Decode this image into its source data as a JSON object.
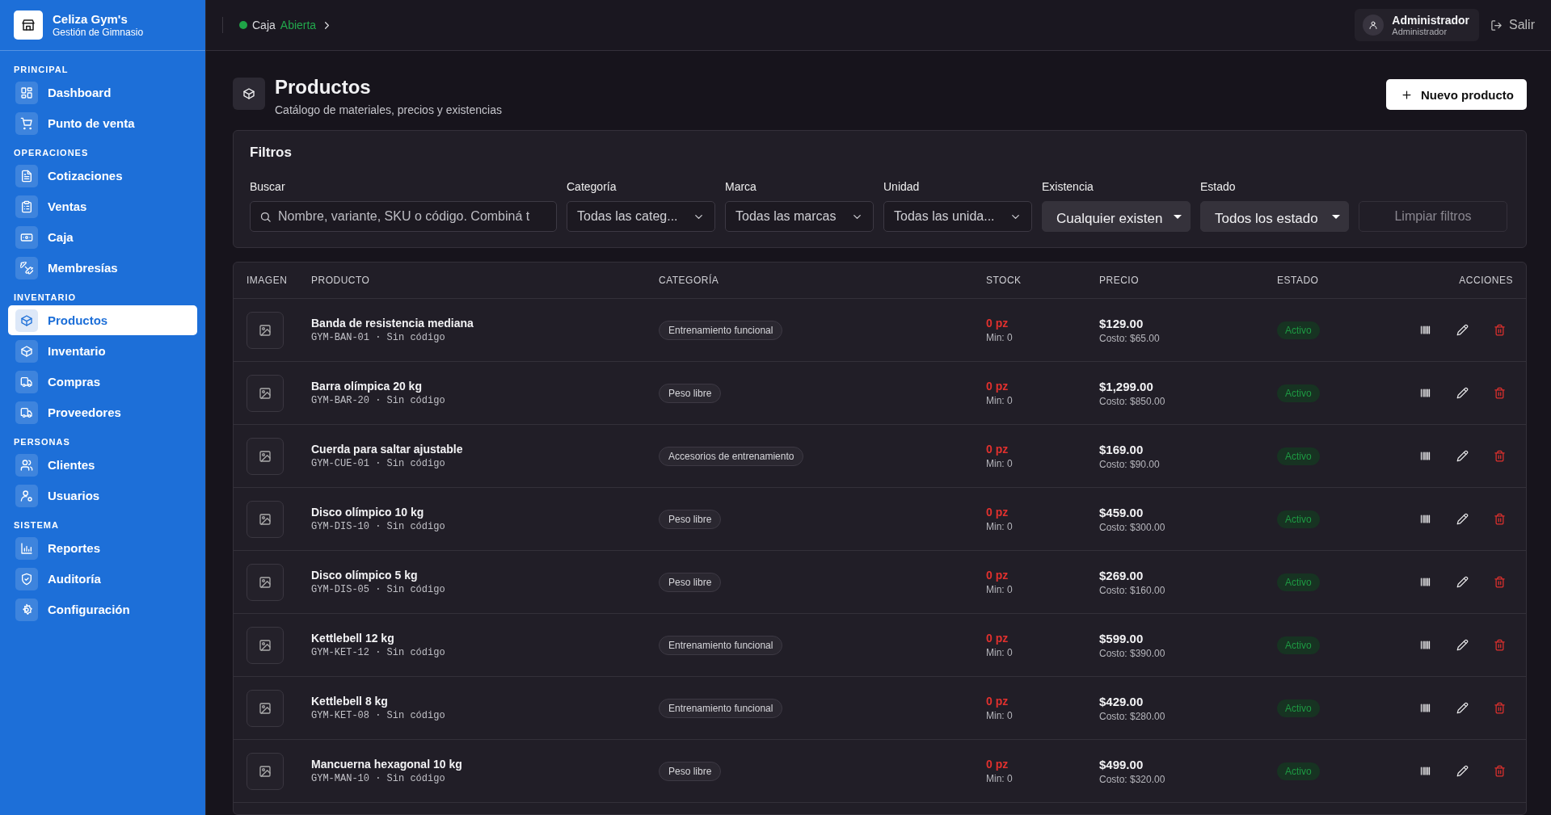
{
  "brand": {
    "name": "Celiza Gym's",
    "subtitle": "Gestión de Gimnasio"
  },
  "sidebar": {
    "sections": [
      {
        "label": "PRINCIPAL",
        "items": [
          {
            "label": "Dashboard",
            "selected": false
          },
          {
            "label": "Punto de venta",
            "selected": false
          }
        ]
      },
      {
        "label": "OPERACIONES",
        "items": [
          {
            "label": "Cotizaciones",
            "selected": false
          },
          {
            "label": "Ventas",
            "selected": false
          },
          {
            "label": "Caja",
            "selected": false
          },
          {
            "label": "Membresías",
            "selected": false
          }
        ]
      },
      {
        "label": "INVENTARIO",
        "items": [
          {
            "label": "Productos",
            "selected": true
          },
          {
            "label": "Inventario",
            "selected": false
          },
          {
            "label": "Compras",
            "selected": false
          },
          {
            "label": "Proveedores",
            "selected": false
          }
        ]
      },
      {
        "label": "PERSONAS",
        "items": [
          {
            "label": "Clientes",
            "selected": false
          },
          {
            "label": "Usuarios",
            "selected": false
          }
        ]
      },
      {
        "label": "SISTEMA",
        "items": [
          {
            "label": "Reportes",
            "selected": false
          },
          {
            "label": "Auditoría",
            "selected": false
          },
          {
            "label": "Configuración",
            "selected": false
          }
        ]
      }
    ]
  },
  "topbar": {
    "register_label": "Caja",
    "register_status": "Abierta",
    "register_open": true,
    "user_name": "Administrador",
    "user_role": "Administrador",
    "logout": "Salir"
  },
  "page": {
    "title": "Productos",
    "subtitle": "Catálogo de materiales, precios y existencias",
    "new_button": "Nuevo producto"
  },
  "filters": {
    "title": "Filtros",
    "fields": [
      {
        "kind": "search",
        "label": "Buscar",
        "placeholder": "Nombre, variante, SKU o código. Combiná t"
      },
      {
        "kind": "select",
        "label": "Categoría",
        "value": "Todas las categ..."
      },
      {
        "kind": "select",
        "label": "Marca",
        "value": "Todas las marcas"
      },
      {
        "kind": "select",
        "label": "Unidad",
        "value": "Todas las unida..."
      },
      {
        "kind": "native",
        "label": "Existencia",
        "value": "Cualquier existen"
      },
      {
        "kind": "native",
        "label": "Estado",
        "value": "Todos los estado"
      }
    ],
    "clear_button": {
      "label": "Limpiar filtros",
      "disabled": true
    }
  },
  "table": {
    "columns": [
      "IMAGEN",
      "PRODUCTO",
      "CATEGORÍA",
      "STOCK",
      "PRECIO",
      "ESTADO",
      "ACCIONES"
    ],
    "rows": [
      {
        "name": "Banda de resistencia mediana",
        "code": "GYM-BAN-01 · Sin código",
        "category": "Entrenamiento funcional",
        "stock": "0 pz",
        "low_stock": true,
        "min": "Min: 0",
        "price": "$129.00",
        "cost": "Costo: $65.00",
        "status": "Activo",
        "active": true
      },
      {
        "name": "Barra olímpica 20 kg",
        "code": "GYM-BAR-20 · Sin código",
        "category": "Peso libre",
        "stock": "0 pz",
        "low_stock": true,
        "min": "Min: 0",
        "price": "$1,299.00",
        "cost": "Costo: $850.00",
        "status": "Activo",
        "active": true
      },
      {
        "name": "Cuerda para saltar ajustable",
        "code": "GYM-CUE-01 · Sin código",
        "category": "Accesorios de entrenamiento",
        "stock": "0 pz",
        "low_stock": true,
        "min": "Min: 0",
        "price": "$169.00",
        "cost": "Costo: $90.00",
        "status": "Activo",
        "active": true
      },
      {
        "name": "Disco olímpico 10 kg",
        "code": "GYM-DIS-10 · Sin código",
        "category": "Peso libre",
        "stock": "0 pz",
        "low_stock": true,
        "min": "Min: 0",
        "price": "$459.00",
        "cost": "Costo: $300.00",
        "status": "Activo",
        "active": true
      },
      {
        "name": "Disco olímpico 5 kg",
        "code": "GYM-DIS-05 · Sin código",
        "category": "Peso libre",
        "stock": "0 pz",
        "low_stock": true,
        "min": "Min: 0",
        "price": "$269.00",
        "cost": "Costo: $160.00",
        "status": "Activo",
        "active": true
      },
      {
        "name": "Kettlebell 12 kg",
        "code": "GYM-KET-12 · Sin código",
        "category": "Entrenamiento funcional",
        "stock": "0 pz",
        "low_stock": true,
        "min": "Min: 0",
        "price": "$599.00",
        "cost": "Costo: $390.00",
        "status": "Activo",
        "active": true
      },
      {
        "name": "Kettlebell 8 kg",
        "code": "GYM-KET-08 · Sin código",
        "category": "Entrenamiento funcional",
        "stock": "0 pz",
        "low_stock": true,
        "min": "Min: 0",
        "price": "$429.00",
        "cost": "Costo: $280.00",
        "status": "Activo",
        "active": true
      },
      {
        "name": "Mancuerna hexagonal 10 kg",
        "code": "GYM-MAN-10 · Sin código",
        "category": "Peso libre",
        "stock": "0 pz",
        "low_stock": true,
        "min": "Min: 0",
        "price": "$499.00",
        "cost": "Costo: $320.00",
        "status": "Activo",
        "active": true
      }
    ]
  }
}
